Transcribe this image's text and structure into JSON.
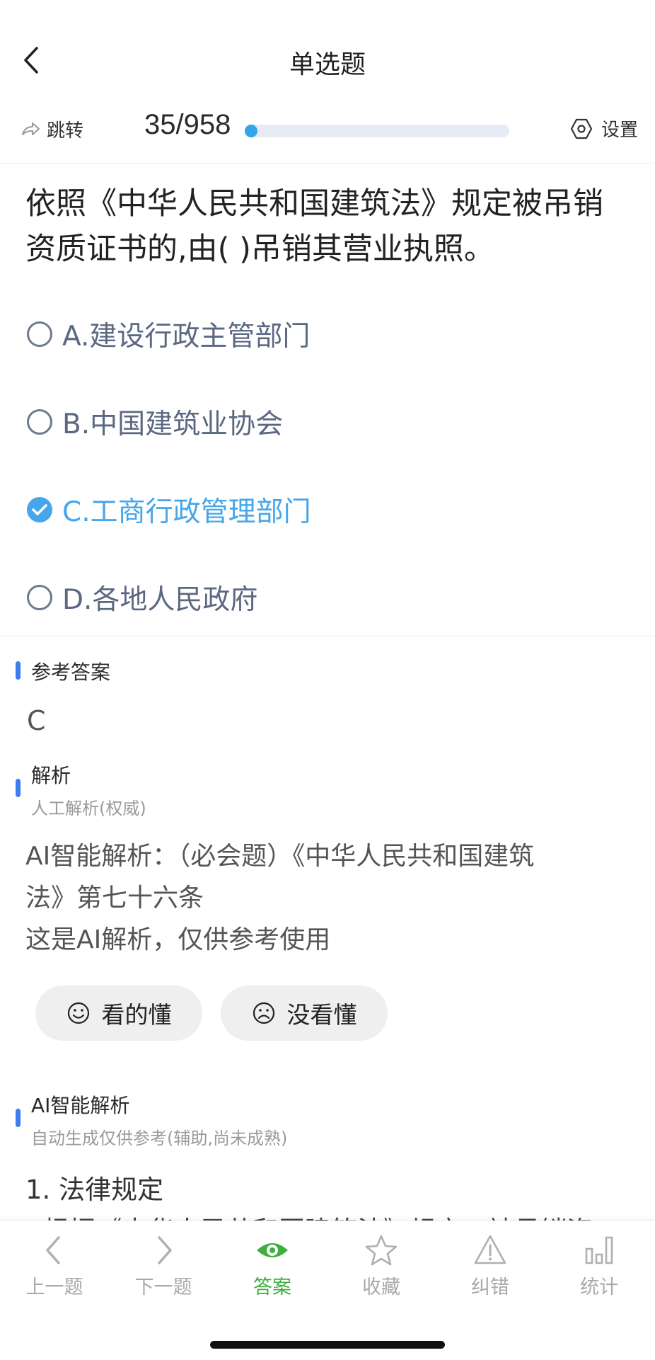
{
  "header": {
    "title": "单选题"
  },
  "toolbar": {
    "jump_label": "跳转",
    "counter": "35/958",
    "progress_fraction": 0.0365,
    "settings_label": "设置"
  },
  "question": {
    "text": "依照《中华人民共和国建筑法》规定被吊销资质证书的,由( )吊销其营业执照。",
    "options": [
      {
        "label": "A.建设行政主管部门",
        "selected": false
      },
      {
        "label": "B.中国建筑业协会",
        "selected": false
      },
      {
        "label": "C.工商行政管理部门",
        "selected": true
      },
      {
        "label": "D.各地人民政府",
        "selected": false
      }
    ]
  },
  "reference": {
    "title": "参考答案",
    "answer": "C"
  },
  "analysis": {
    "title": "解析",
    "subtitle": "人工解析(权威)",
    "line1": "AI智能解析：（必会题）《中华人民共和国建筑",
    "line2": "法》第七十六条",
    "line3": "这是AI解析，仅供参考使用",
    "understood_label": "看的懂",
    "not_understood_label": "没看懂"
  },
  "ai_analysis": {
    "title": "AI智能解析",
    "subtitle": "自动生成仅供参考(辅助,尚未成熟)",
    "line1": "1. 法律规定",
    "line2": "- 根据《中华人民共和国建筑法》规定，被吊销资"
  },
  "bottom_nav": [
    {
      "label": "上一题",
      "icon": "chevron-left-icon"
    },
    {
      "label": "下一题",
      "icon": "chevron-right-icon"
    },
    {
      "label": "答案",
      "icon": "eye-icon",
      "active": true
    },
    {
      "label": "收藏",
      "icon": "star-icon"
    },
    {
      "label": "纠错",
      "icon": "warning-icon"
    },
    {
      "label": "统计",
      "icon": "bar-chart-icon"
    }
  ],
  "colors": {
    "accent_blue": "#46a6ea",
    "progress_blue": "#32a6e6",
    "section_bar": "#3a7ef0",
    "active_green": "#3fae3f"
  }
}
